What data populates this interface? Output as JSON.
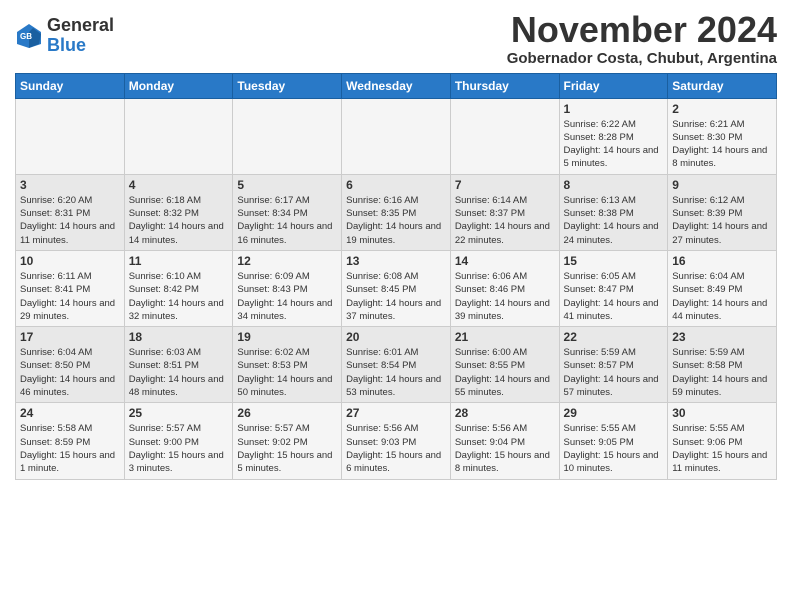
{
  "header": {
    "logo_general": "General",
    "logo_blue": "Blue",
    "month_title": "November 2024",
    "subtitle": "Gobernador Costa, Chubut, Argentina"
  },
  "weekdays": [
    "Sunday",
    "Monday",
    "Tuesday",
    "Wednesday",
    "Thursday",
    "Friday",
    "Saturday"
  ],
  "weeks": [
    [
      {
        "day": "",
        "info": ""
      },
      {
        "day": "",
        "info": ""
      },
      {
        "day": "",
        "info": ""
      },
      {
        "day": "",
        "info": ""
      },
      {
        "day": "",
        "info": ""
      },
      {
        "day": "1",
        "info": "Sunrise: 6:22 AM\nSunset: 8:28 PM\nDaylight: 14 hours\nand 5 minutes."
      },
      {
        "day": "2",
        "info": "Sunrise: 6:21 AM\nSunset: 8:30 PM\nDaylight: 14 hours\nand 8 minutes."
      }
    ],
    [
      {
        "day": "3",
        "info": "Sunrise: 6:20 AM\nSunset: 8:31 PM\nDaylight: 14 hours\nand 11 minutes."
      },
      {
        "day": "4",
        "info": "Sunrise: 6:18 AM\nSunset: 8:32 PM\nDaylight: 14 hours\nand 14 minutes."
      },
      {
        "day": "5",
        "info": "Sunrise: 6:17 AM\nSunset: 8:34 PM\nDaylight: 14 hours\nand 16 minutes."
      },
      {
        "day": "6",
        "info": "Sunrise: 6:16 AM\nSunset: 8:35 PM\nDaylight: 14 hours\nand 19 minutes."
      },
      {
        "day": "7",
        "info": "Sunrise: 6:14 AM\nSunset: 8:37 PM\nDaylight: 14 hours\nand 22 minutes."
      },
      {
        "day": "8",
        "info": "Sunrise: 6:13 AM\nSunset: 8:38 PM\nDaylight: 14 hours\nand 24 minutes."
      },
      {
        "day": "9",
        "info": "Sunrise: 6:12 AM\nSunset: 8:39 PM\nDaylight: 14 hours\nand 27 minutes."
      }
    ],
    [
      {
        "day": "10",
        "info": "Sunrise: 6:11 AM\nSunset: 8:41 PM\nDaylight: 14 hours\nand 29 minutes."
      },
      {
        "day": "11",
        "info": "Sunrise: 6:10 AM\nSunset: 8:42 PM\nDaylight: 14 hours\nand 32 minutes."
      },
      {
        "day": "12",
        "info": "Sunrise: 6:09 AM\nSunset: 8:43 PM\nDaylight: 14 hours\nand 34 minutes."
      },
      {
        "day": "13",
        "info": "Sunrise: 6:08 AM\nSunset: 8:45 PM\nDaylight: 14 hours\nand 37 minutes."
      },
      {
        "day": "14",
        "info": "Sunrise: 6:06 AM\nSunset: 8:46 PM\nDaylight: 14 hours\nand 39 minutes."
      },
      {
        "day": "15",
        "info": "Sunrise: 6:05 AM\nSunset: 8:47 PM\nDaylight: 14 hours\nand 41 minutes."
      },
      {
        "day": "16",
        "info": "Sunrise: 6:04 AM\nSunset: 8:49 PM\nDaylight: 14 hours\nand 44 minutes."
      }
    ],
    [
      {
        "day": "17",
        "info": "Sunrise: 6:04 AM\nSunset: 8:50 PM\nDaylight: 14 hours\nand 46 minutes."
      },
      {
        "day": "18",
        "info": "Sunrise: 6:03 AM\nSunset: 8:51 PM\nDaylight: 14 hours\nand 48 minutes."
      },
      {
        "day": "19",
        "info": "Sunrise: 6:02 AM\nSunset: 8:53 PM\nDaylight: 14 hours\nand 50 minutes."
      },
      {
        "day": "20",
        "info": "Sunrise: 6:01 AM\nSunset: 8:54 PM\nDaylight: 14 hours\nand 53 minutes."
      },
      {
        "day": "21",
        "info": "Sunrise: 6:00 AM\nSunset: 8:55 PM\nDaylight: 14 hours\nand 55 minutes."
      },
      {
        "day": "22",
        "info": "Sunrise: 5:59 AM\nSunset: 8:57 PM\nDaylight: 14 hours\nand 57 minutes."
      },
      {
        "day": "23",
        "info": "Sunrise: 5:59 AM\nSunset: 8:58 PM\nDaylight: 14 hours\nand 59 minutes."
      }
    ],
    [
      {
        "day": "24",
        "info": "Sunrise: 5:58 AM\nSunset: 8:59 PM\nDaylight: 15 hours\nand 1 minute."
      },
      {
        "day": "25",
        "info": "Sunrise: 5:57 AM\nSunset: 9:00 PM\nDaylight: 15 hours\nand 3 minutes."
      },
      {
        "day": "26",
        "info": "Sunrise: 5:57 AM\nSunset: 9:02 PM\nDaylight: 15 hours\nand 5 minutes."
      },
      {
        "day": "27",
        "info": "Sunrise: 5:56 AM\nSunset: 9:03 PM\nDaylight: 15 hours\nand 6 minutes."
      },
      {
        "day": "28",
        "info": "Sunrise: 5:56 AM\nSunset: 9:04 PM\nDaylight: 15 hours\nand 8 minutes."
      },
      {
        "day": "29",
        "info": "Sunrise: 5:55 AM\nSunset: 9:05 PM\nDaylight: 15 hours\nand 10 minutes."
      },
      {
        "day": "30",
        "info": "Sunrise: 5:55 AM\nSunset: 9:06 PM\nDaylight: 15 hours\nand 11 minutes."
      }
    ]
  ]
}
